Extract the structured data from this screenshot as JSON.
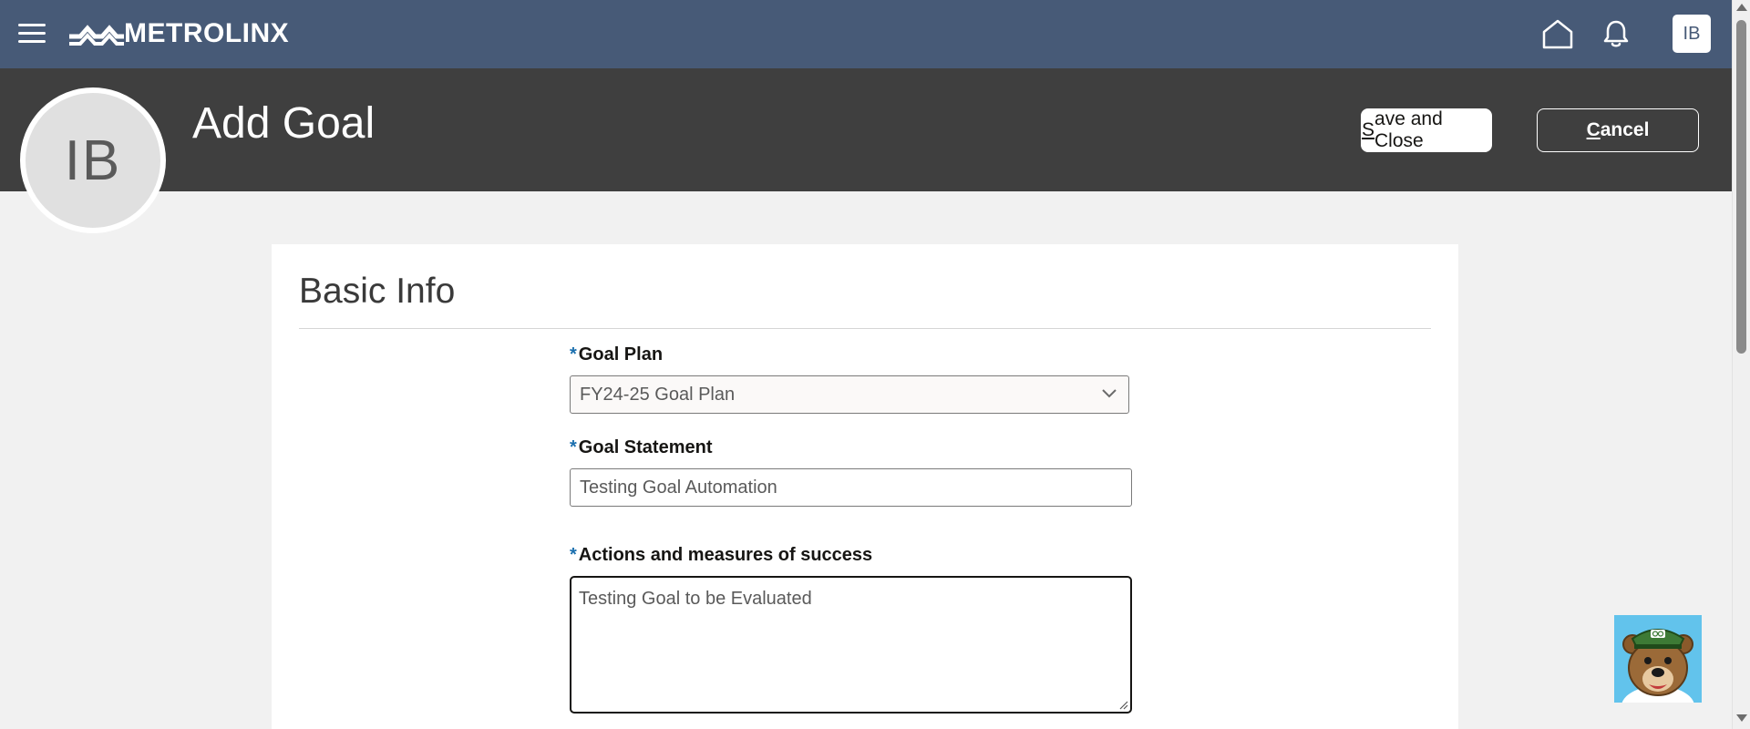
{
  "brand": {
    "name": "METROLINX",
    "bar_color": "#475a77"
  },
  "topbar": {
    "icons": [
      "hamburger-menu-icon",
      "home-icon",
      "bell-icon"
    ],
    "user_initials": "IB"
  },
  "header": {
    "avatar_initials": "IB",
    "title": "Add Goal",
    "save_label_first": "S",
    "save_label_rest": "ave and Close",
    "cancel_label_first": "C",
    "cancel_label_rest": "ancel"
  },
  "section": {
    "title": "Basic Info"
  },
  "form": {
    "goal_plan": {
      "required_mark": "*",
      "label": "Goal Plan",
      "value": "FY24-25 Goal Plan"
    },
    "goal_statement": {
      "required_mark": "*",
      "label": "Goal Statement",
      "value": "Testing Goal Automation"
    },
    "actions": {
      "required_mark": "*",
      "label": "Actions and measures of success",
      "value": "Testing Goal to be Evaluated"
    }
  },
  "assistant": {
    "icon": "bear-mascot-icon"
  }
}
